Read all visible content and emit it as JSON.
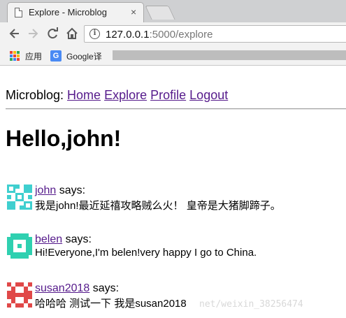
{
  "browser": {
    "tab_title": "Explore - Microblog",
    "tab_close": "×",
    "url_host": "127.0.0.1",
    "url_rest": ":5000/explore",
    "bookmarks": [
      {
        "label": "应用",
        "icon": "apps-grid-icon"
      },
      {
        "label": "Google译",
        "icon": "google-translate-icon"
      }
    ],
    "nav_icons": [
      "back-arrow-icon",
      "forward-arrow-icon",
      "reload-icon",
      "home-icon",
      "info-icon"
    ]
  },
  "page": {
    "brand": "Microblog:",
    "nav": [
      {
        "label": "Home"
      },
      {
        "label": "Explore"
      },
      {
        "label": "Profile"
      },
      {
        "label": "Logout"
      }
    ],
    "greeting": "Hello,john!",
    "says": "says:",
    "posts": [
      {
        "author": "john",
        "body": "我是john!最近延禧攻略贼么火！ 皇帝是大猪脚蹄子。",
        "avatar_color": "#3fcfcf"
      },
      {
        "author": "belen",
        "body": "Hi!Everyone,I'm belen!very happy I go to China.",
        "avatar_color": "#2fd0b0"
      },
      {
        "author": "susan2018",
        "body": "哈哈哈 测试一下 我是susan2018",
        "avatar_color": "#e04848"
      }
    ]
  },
  "watermark": "net/weixin_38256474",
  "colors": {
    "link_visited": "#551a8b",
    "chrome_bg": "#f2f2f2",
    "tabstrip_bg": "#cfd0d2"
  }
}
